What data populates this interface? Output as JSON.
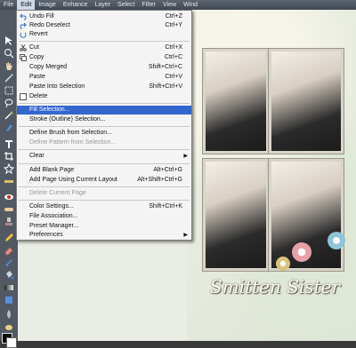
{
  "menubar": {
    "items": [
      "File",
      "Edit",
      "Image",
      "Enhance",
      "Layer",
      "Select",
      "Filter",
      "View",
      "Wind"
    ],
    "active_index": 1
  },
  "edit_menu": {
    "items": [
      {
        "label": "Undo Fill",
        "shortcut": "Ctrl+Z",
        "icon": "undo-icon",
        "disabled": false
      },
      {
        "label": "Redo Deselect",
        "shortcut": "Ctrl+Y",
        "icon": "redo-icon",
        "disabled": false
      },
      {
        "label": "Revert",
        "shortcut": "",
        "icon": "revert-icon",
        "disabled": false
      },
      {
        "label": "Cut",
        "shortcut": "Ctrl+X",
        "icon": "cut-icon",
        "disabled": false
      },
      {
        "label": "Copy",
        "shortcut": "Ctrl+C",
        "icon": "copy-icon",
        "disabled": false
      },
      {
        "label": "Copy Merged",
        "shortcut": "Shift+Ctrl+C",
        "icon": "",
        "disabled": false
      },
      {
        "label": "Paste",
        "shortcut": "Ctrl+V",
        "icon": "",
        "disabled": false
      },
      {
        "label": "Paste Into Selection",
        "shortcut": "Shift+Ctrl+V",
        "icon": "",
        "disabled": false
      },
      {
        "label": "Delete",
        "shortcut": "",
        "icon": "delete-icon",
        "disabled": false
      },
      {
        "label": "Fill Selection...",
        "shortcut": "",
        "icon": "",
        "disabled": false,
        "highlighted": true
      },
      {
        "label": "Stroke (Outline) Selection...",
        "shortcut": "",
        "icon": "",
        "disabled": false
      },
      {
        "label": "Define Brush from Selection...",
        "shortcut": "",
        "icon": "",
        "disabled": false
      },
      {
        "label": "Define Pattern from Selection...",
        "shortcut": "",
        "icon": "",
        "disabled": true
      },
      {
        "label": "Clear",
        "shortcut": "",
        "icon": "",
        "disabled": false,
        "submenu": true
      },
      {
        "label": "Add Blank Page",
        "shortcut": "Alt+Ctrl+G",
        "icon": "",
        "disabled": false
      },
      {
        "label": "Add Page Using Current Layout",
        "shortcut": "Alt+Shift+Ctrl+G",
        "icon": "",
        "disabled": false
      },
      {
        "label": "Delete Current Page",
        "shortcut": "",
        "icon": "",
        "disabled": true
      },
      {
        "label": "Color Settings...",
        "shortcut": "Shift+Ctrl+K",
        "icon": "",
        "disabled": false
      },
      {
        "label": "File Association...",
        "shortcut": "",
        "icon": "",
        "disabled": false
      },
      {
        "label": "Preset Manager...",
        "shortcut": "",
        "icon": "",
        "disabled": false
      },
      {
        "label": "Preferences",
        "shortcut": "",
        "icon": "",
        "disabled": false,
        "submenu": true
      }
    ]
  },
  "colors": {
    "menu_highlight": "#3366cc",
    "menubar_bg": "#4a525c",
    "tools_bg": "#525962"
  },
  "canvas": {
    "title_art": "Smitten Sister"
  }
}
